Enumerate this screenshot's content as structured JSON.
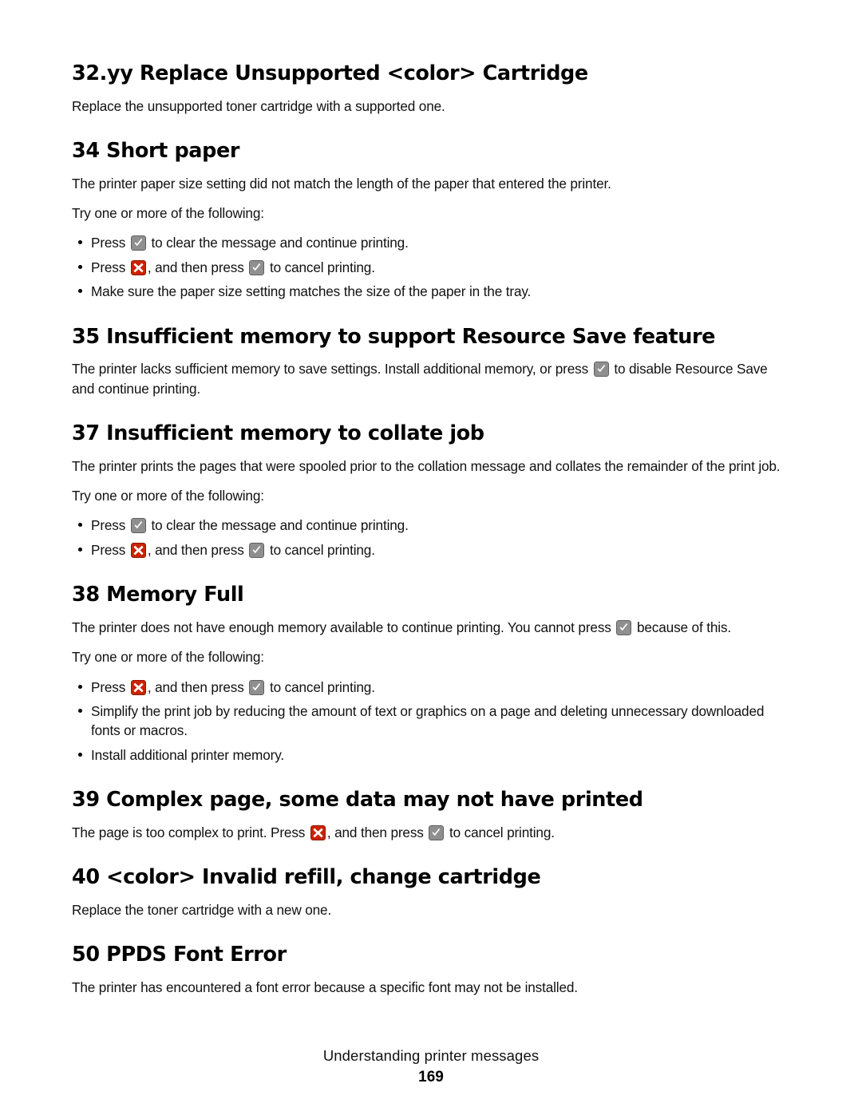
{
  "page": {
    "footer_title": "Understanding printer messages",
    "page_number": "169"
  },
  "icons": {
    "check_key": {
      "name": "check-key-icon",
      "body_color": "#8f8f8f",
      "edge_color": "#5e5e5e",
      "glyph_color": "#ffffff",
      "label": "checkmark key"
    },
    "x_key": {
      "name": "stop-key-icon",
      "body_color": "#cc2200",
      "edge_color": "#8f1800",
      "glyph_color": "#ffffff",
      "label": "red X stop key"
    }
  },
  "sections": [
    {
      "id": "msg-32yy",
      "heading": "32.yy Replace Unsupported <color> Cartridge",
      "paragraph_1": "Replace the unsupported toner cartridge with a supported one."
    },
    {
      "id": "msg-34",
      "heading": "34 Short paper",
      "paragraph_1": "The printer paper size setting did not match the length of the paper that entered the printer.",
      "paragraph_2": "Try one or more of the following:",
      "bullets": {
        "b1_before": "Press",
        "b1_after": "to clear the message and continue printing.",
        "b2_before": "Press",
        "b2_middle": ", and then press",
        "b2_after": "to cancel printing.",
        "b3": "Make sure the paper size setting matches the size of the paper in the tray."
      }
    },
    {
      "id": "msg-35",
      "heading": "35 Insufficient memory to support Resource Save feature",
      "paragraph_1_before": "The printer lacks sufficient memory to save settings. Install additional memory, or press",
      "paragraph_1_after": "to disable Resource Save and continue printing."
    },
    {
      "id": "msg-37",
      "heading": "37 Insufficient memory to collate job",
      "paragraph_1": "The printer prints the pages that were spooled prior to the collation message and collates the remainder of the print job.",
      "paragraph_2": "Try one or more of the following:",
      "bullets": {
        "b1_before": "Press",
        "b1_after": "to clear the message and continue printing.",
        "b2_before": "Press",
        "b2_middle": ", and then press",
        "b2_after": "to cancel printing."
      }
    },
    {
      "id": "msg-38",
      "heading": "38 Memory Full",
      "paragraph_1_before": "The printer does not have enough memory available to continue printing. You cannot press",
      "paragraph_1_after": "because of this.",
      "paragraph_2": "Try one or more of the following:",
      "bullets": {
        "b1_before": "Press",
        "b1_middle": ", and then press",
        "b1_after": "to cancel printing.",
        "b2": "Simplify the print job by reducing the amount of text or graphics on a page and deleting unnecessary downloaded fonts or macros.",
        "b3": "Install additional printer memory."
      }
    },
    {
      "id": "msg-39",
      "heading": "39 Complex page, some data may not have printed",
      "paragraph_1_before": "The page is too complex to print. Press",
      "paragraph_1_middle": ", and then press",
      "paragraph_1_after": "to cancel printing."
    },
    {
      "id": "msg-40",
      "heading": "40 <color> Invalid refill, change cartridge",
      "paragraph_1": "Replace the toner cartridge with a new one."
    },
    {
      "id": "msg-50",
      "heading": "50 PPDS Font Error",
      "paragraph_1": "The printer has encountered a font error because a specific font may not be installed."
    }
  ]
}
